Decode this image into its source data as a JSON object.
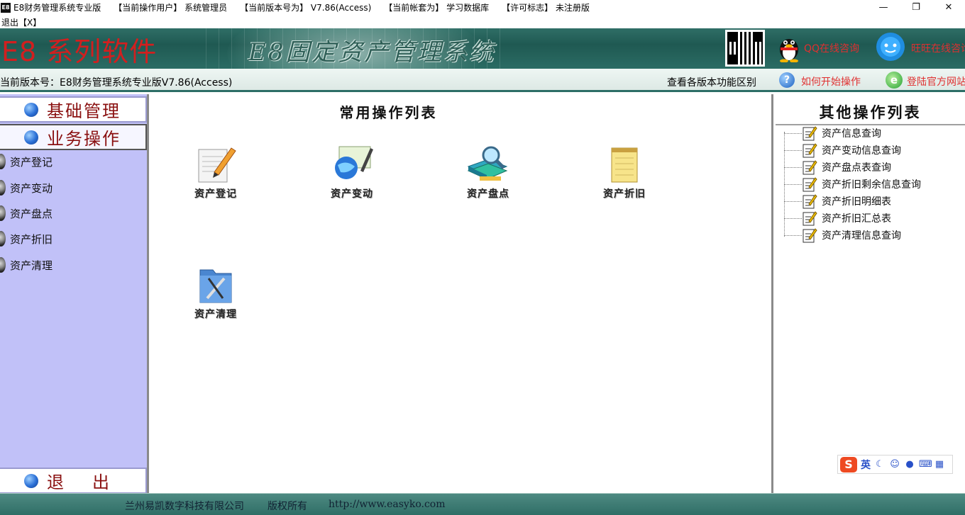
{
  "titlebar": {
    "app_icon": "E8",
    "app_name": "E8财务管理系统专业版",
    "user_label": "【当前操作用户】",
    "user_value": "系统管理员",
    "version_label": "【当前版本号为】",
    "version_value": "V7.86(Access)",
    "account_label": "【当前帐套为】",
    "account_value": "学习数据库",
    "license_label": "【许可标志】",
    "license_value": "未注册版",
    "minimize_icon": "minimize-icon",
    "restore_icon": "restore-icon",
    "close_icon": "close-icon"
  },
  "menubar": {
    "exit": "退出【X】"
  },
  "banner": {
    "logo": "E8 系列软件",
    "system_name": "E8固定资产管理系统",
    "qq_text": "QQ在线咨询",
    "ali_text": "旺旺在线咨询"
  },
  "versionbar": {
    "version_text": "当前版本号：E8财务管理系统专业版V7.86(Access)",
    "compare_link": "查看各版本功能区别",
    "help_link": "如何开始操作",
    "web_link": "登陆官方网站"
  },
  "sidebar": {
    "basic_mgmt": "基础管理",
    "business_ops": "业务操作",
    "items": [
      {
        "label": "资产登记"
      },
      {
        "label": "资产变动"
      },
      {
        "label": "资产盘点"
      },
      {
        "label": "资产折旧"
      },
      {
        "label": "资产清理"
      }
    ],
    "exit": "退出"
  },
  "center": {
    "title": "常用操作列表",
    "ops": [
      {
        "label": "资产登记",
        "icon": "notepad-pencil-icon"
      },
      {
        "label": "资产变动",
        "icon": "globe-pen-icon"
      },
      {
        "label": "资产盘点",
        "icon": "books-magnifier-icon"
      },
      {
        "label": "资产折旧",
        "icon": "notepad-icon"
      },
      {
        "label": "资产清理",
        "icon": "folder-tools-icon"
      }
    ]
  },
  "right": {
    "title": "其他操作列表",
    "items": [
      {
        "label": "资产信息查询"
      },
      {
        "label": "资产变动信息查询"
      },
      {
        "label": "资产盘点表查询"
      },
      {
        "label": "资产折旧剩余信息查询"
      },
      {
        "label": "资产折旧明细表"
      },
      {
        "label": "资产折旧汇总表"
      },
      {
        "label": "资产清理信息查询"
      }
    ]
  },
  "ime": {
    "logo": "S",
    "lang": "英"
  },
  "footer": {
    "company": "兰州易凯数字科技有限公司",
    "rights": "版权所有",
    "url": "http://www.easyko.com"
  },
  "colors": {
    "banner": "#1f5952",
    "sidebar": "#c1c1f8",
    "link_red": "#e03030",
    "header_text": "#8a1010"
  }
}
